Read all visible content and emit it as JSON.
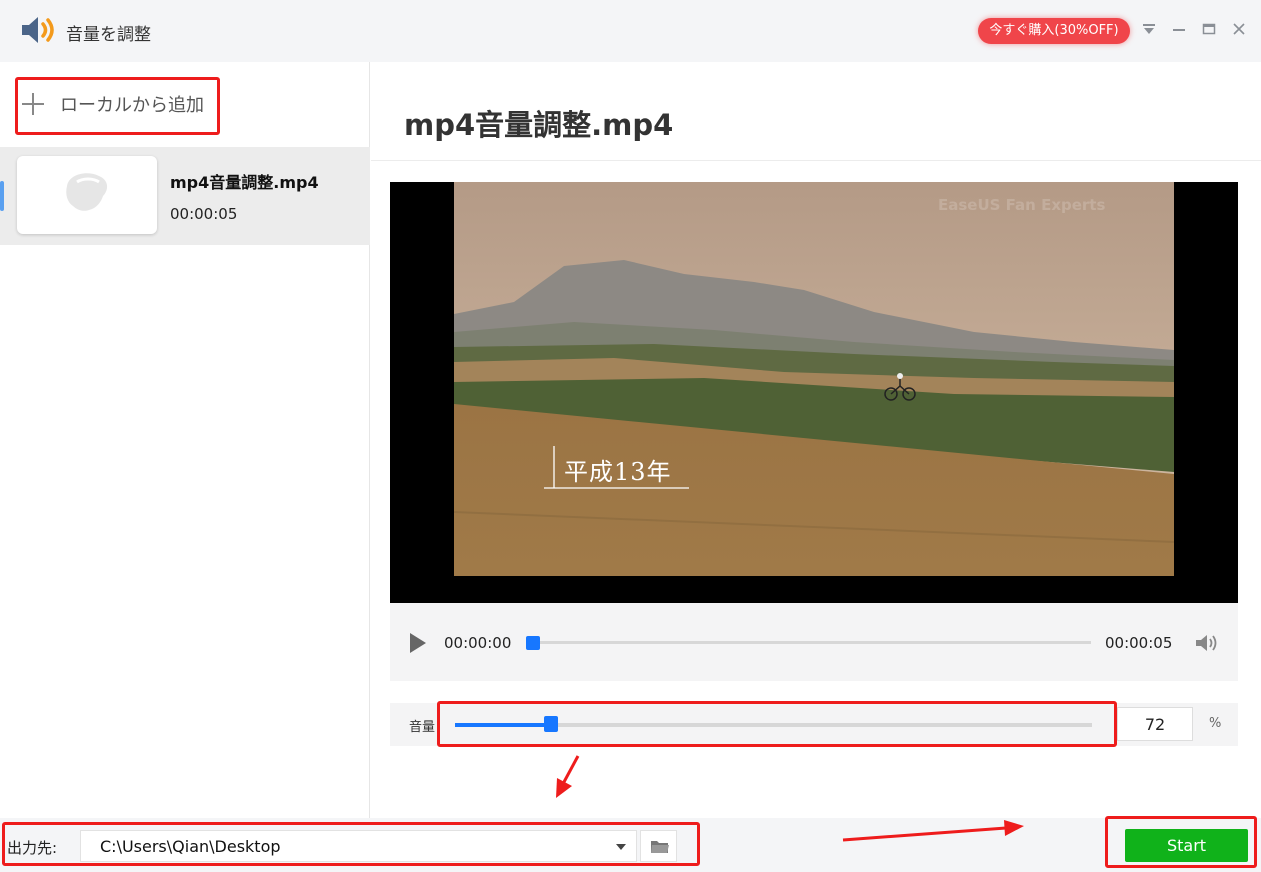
{
  "window": {
    "title": "音量を調整",
    "promo_label": "今すぐ購入(30%OFF)",
    "icons": [
      "speaker-orange-icon",
      "menu-icon",
      "minimize-icon",
      "maximize-icon",
      "close-icon"
    ],
    "accent": "#f0454a"
  },
  "sidebar": {
    "add_label": "ローカルから追加",
    "files": [
      {
        "name": "mp4音量調整.mp4",
        "duration": "00:00:05"
      }
    ]
  },
  "main": {
    "title": "mp4音量調整.mp4",
    "video": {
      "watermark": "EaseUS Fan Experts",
      "subtitle": "平成13年"
    },
    "player": {
      "current_time": "00:00:00",
      "total_time": "00:00:05",
      "progress": 0
    },
    "volume": {
      "label": "音量",
      "value": "72",
      "level": 0.15,
      "unit": "%"
    }
  },
  "bottom": {
    "output_label": "出力先:",
    "output_path": "C:\\Users\\Qian\\Desktop",
    "start_label": "Start",
    "start_color": "#10b21a"
  },
  "annotation_color": "#ee1c1c"
}
